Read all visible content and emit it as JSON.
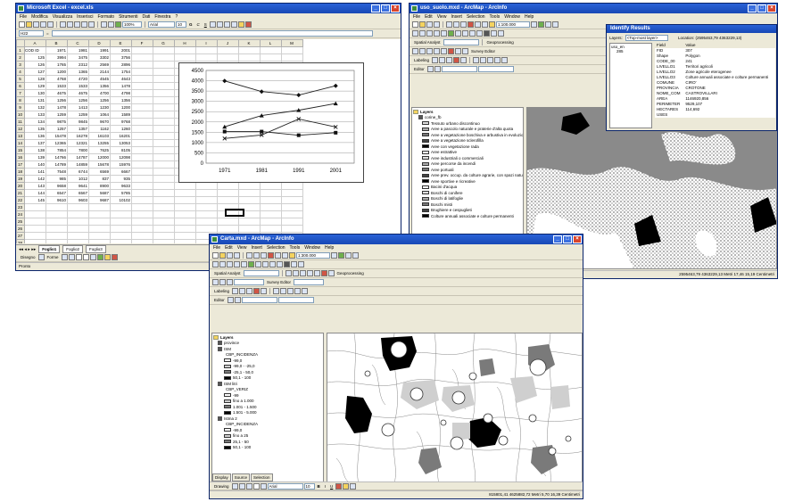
{
  "excel": {
    "title": "Microsoft Excel - excel.xls",
    "menu": [
      "File",
      "Modifica",
      "Visualizza",
      "Inserisci",
      "Formato",
      "Strumenti",
      "Dati",
      "Finestra",
      "?"
    ],
    "zoom": "100%",
    "font": "Arial",
    "font_size": "10",
    "name_box": "H22",
    "columns": [
      "A",
      "B",
      "C",
      "D",
      "E",
      "F",
      "G",
      "H",
      "I",
      "J",
      "K",
      "L",
      "M"
    ],
    "rows": [
      [
        "COD ID",
        "1971",
        "1981",
        "1991",
        "2001"
      ],
      [
        "125",
        "3994",
        "3475",
        "3302",
        "3756"
      ],
      [
        "126",
        "1765",
        "2312",
        "2569",
        "2896"
      ],
      [
        "127",
        "1200",
        "1365",
        "2144",
        "1754"
      ],
      [
        "128",
        "4768",
        "4720",
        "4545",
        "4643"
      ],
      [
        "129",
        "1533",
        "1533",
        "1356",
        "1478"
      ],
      [
        "130",
        "4675",
        "4675",
        "4700",
        "4798"
      ],
      [
        "131",
        "1256",
        "1256",
        "1256",
        "1356"
      ],
      [
        "132",
        "1478",
        "1413",
        "1230",
        "1200"
      ],
      [
        "133",
        "1259",
        "1259",
        "1064",
        "1589"
      ],
      [
        "134",
        "9875",
        "9845",
        "9670",
        "9768"
      ],
      [
        "135",
        "1257",
        "1357",
        "1162",
        "1260"
      ],
      [
        "136",
        "15478",
        "16278",
        "16103",
        "16201"
      ],
      [
        "137",
        "12365",
        "12321",
        "13255",
        "13053"
      ],
      [
        "138",
        "7854",
        "7800",
        "7625",
        "8105"
      ],
      [
        "139",
        "14766",
        "14787",
        "12000",
        "12098"
      ],
      [
        "140",
        "14789",
        "14859",
        "15678",
        "15976"
      ],
      [
        "141",
        "7548",
        "6744",
        "6569",
        "6667"
      ],
      [
        "142",
        "985",
        "1012",
        "837",
        "935"
      ],
      [
        "143",
        "9658",
        "9641",
        "8900",
        "9633"
      ],
      [
        "144",
        "6547",
        "6567",
        "5687",
        "5785"
      ],
      [
        "145",
        "9610",
        "9603",
        "9687",
        "10102"
      ]
    ],
    "extra_row_numbers": [
      "23",
      "24",
      "25",
      "26",
      "27",
      "28",
      "29",
      "30"
    ],
    "sheets": [
      "Foglio1",
      "Foglio2",
      "Foglio3"
    ],
    "drawing_label": "Disegno",
    "shapes_label": "Forme",
    "status": "Pronto"
  },
  "chart_data": {
    "type": "line",
    "x": [
      "1971",
      "1981",
      "1991",
      "2001"
    ],
    "ylim": [
      0,
      4500
    ],
    "yticks": [
      0,
      500,
      1000,
      1500,
      2000,
      2500,
      3000,
      3500,
      4000,
      4500
    ],
    "series": [
      {
        "values": [
          3994,
          3475,
          3302,
          3756
        ],
        "marker": "diamond"
      },
      {
        "values": [
          1765,
          2312,
          2569,
          2896
        ],
        "marker": "triangle"
      },
      {
        "values": [
          1200,
          1365,
          2144,
          1754
        ],
        "marker": "cross"
      },
      {
        "values": [
          1533,
          1533,
          1356,
          1478
        ],
        "marker": "square"
      }
    ],
    "grid": true,
    "legend": "none"
  },
  "arcmap_top": {
    "title": "uso_suolo.mxd - ArcMap - ArcInfo",
    "menu": [
      "File",
      "Edit",
      "View",
      "Insert",
      "Selection",
      "Tools",
      "Window",
      "Help"
    ],
    "scale": "1:100.000",
    "spatial_analyst": "Spatial Analyst",
    "geoprocessing": "Geoprocessing",
    "survey_editor": "Survey Editor",
    "labeling": "Labeling",
    "editor": "Editor",
    "toc_title": "Layers",
    "toc_items": [
      "corine_fb",
      "Tessuto urbano discontinuo",
      "Aree a pascolo naturale e praterie d'alta quota",
      "Aree a vegetazione boschiva e arbustiva in evoluzione",
      "Aree a vegetazione sclerofilla",
      "Aree con vegetazione rada",
      "Aree estrattive",
      "Aree industriali o commerciali",
      "Aree percorse da incendi",
      "Aree portuali",
      "Aree prev. occup. da colture agrarie, con spazi naturali",
      "Aree sportive e ricreative",
      "Bacini d'acqua",
      "Boschi di conifere",
      "Boschi di latifoglie",
      "Boschi misti",
      "Brughiere e cespuglieti",
      "Colture annuali associate e colture permanenti"
    ],
    "status_coords": "2595463,79  4363229,13 Metri  17,46  15,19 Centimetri"
  },
  "identify": {
    "title": "Identify Results",
    "layers_label": "Layers:",
    "layers_value": "<Top-most layer>",
    "location_label": "Location:",
    "location_value": "(2595463,79  4363229,13)",
    "tree": [
      "uso_en",
      "285"
    ],
    "headers": [
      "Field",
      "Value"
    ],
    "fields": [
      [
        "FID",
        "307"
      ],
      [
        "Shape",
        "Polygon"
      ],
      [
        "CODE_00",
        "241"
      ],
      [
        "LIVELLO1",
        "Territori agricoli"
      ],
      [
        "LIVELLO2",
        "Zone agricole eterogenee"
      ],
      [
        "LIVELLO3",
        "Colture annuali associate e colture permanenti"
      ],
      [
        "COMUNE",
        "CIRO'"
      ],
      [
        "PROVINCIA",
        "CROTONE"
      ],
      [
        "NOME_COM",
        "CASTROVILLARI"
      ],
      [
        "AREA",
        "1146920,856"
      ],
      [
        "PERIMETER",
        "9529,107"
      ],
      [
        "HECTARES",
        "114,692"
      ],
      [
        "USES",
        ""
      ]
    ]
  },
  "arcmap_front": {
    "title": "Carta.mxd - ArcMap - ArcInfo",
    "menu": [
      "File",
      "Edit",
      "View",
      "Insert",
      "Selection",
      "Tools",
      "Window",
      "Help"
    ],
    "scale": "1:300.000",
    "spatial_analyst": "Spatial Analyst",
    "geoprocessing": "Geoprocessing",
    "survey_editor": "Survey Editor",
    "labeling": "Labeling",
    "editor": "Editor",
    "toc_title": "Layers",
    "toc_items": [
      {
        "label": "province",
        "kind": "layer"
      },
      {
        "label": "ISM",
        "kind": "layer"
      },
      {
        "label": "CBP_INCIDENZA",
        "kind": "field"
      },
      {
        "label": "-99,0",
        "kind": "class"
      },
      {
        "label": "-99,0 - -25,0",
        "kind": "class"
      },
      {
        "label": "-25,1 - 50,0",
        "kind": "class"
      },
      {
        "label": "50,1 - 100",
        "kind": "class"
      },
      {
        "label": "ISM litri",
        "kind": "layer"
      },
      {
        "label": "CBP_VERIZ",
        "kind": "field"
      },
      {
        "label": "-99",
        "kind": "class"
      },
      {
        "label": "fino a 1.000",
        "kind": "class"
      },
      {
        "label": "1.001 - 1.500",
        "kind": "class"
      },
      {
        "label": "1.501 - 5.000",
        "kind": "class"
      },
      {
        "label": "Istma 2",
        "kind": "layer"
      },
      {
        "label": "CBP_INCIDENZA",
        "kind": "field"
      },
      {
        "label": "-99,0",
        "kind": "class"
      },
      {
        "label": "fino a 25",
        "kind": "class"
      },
      {
        "label": "25,1 - 50",
        "kind": "class"
      },
      {
        "label": "50,1 - 100",
        "kind": "class"
      }
    ],
    "toc_tabs": [
      "Display",
      "Source",
      "Selection"
    ],
    "drawing_label": "Drawing",
    "font": "Arial",
    "font_size": "10",
    "status_coords": "815801,41  4625882,72 Metri  5,70  16,39 Centimetri"
  },
  "colors": {
    "titlebar": "#2a62d6",
    "chrome": "#ece9d8",
    "dark_fill": "#000000",
    "mid_fill": "#7a7a7a",
    "light_fill": "#cfcfcf"
  }
}
